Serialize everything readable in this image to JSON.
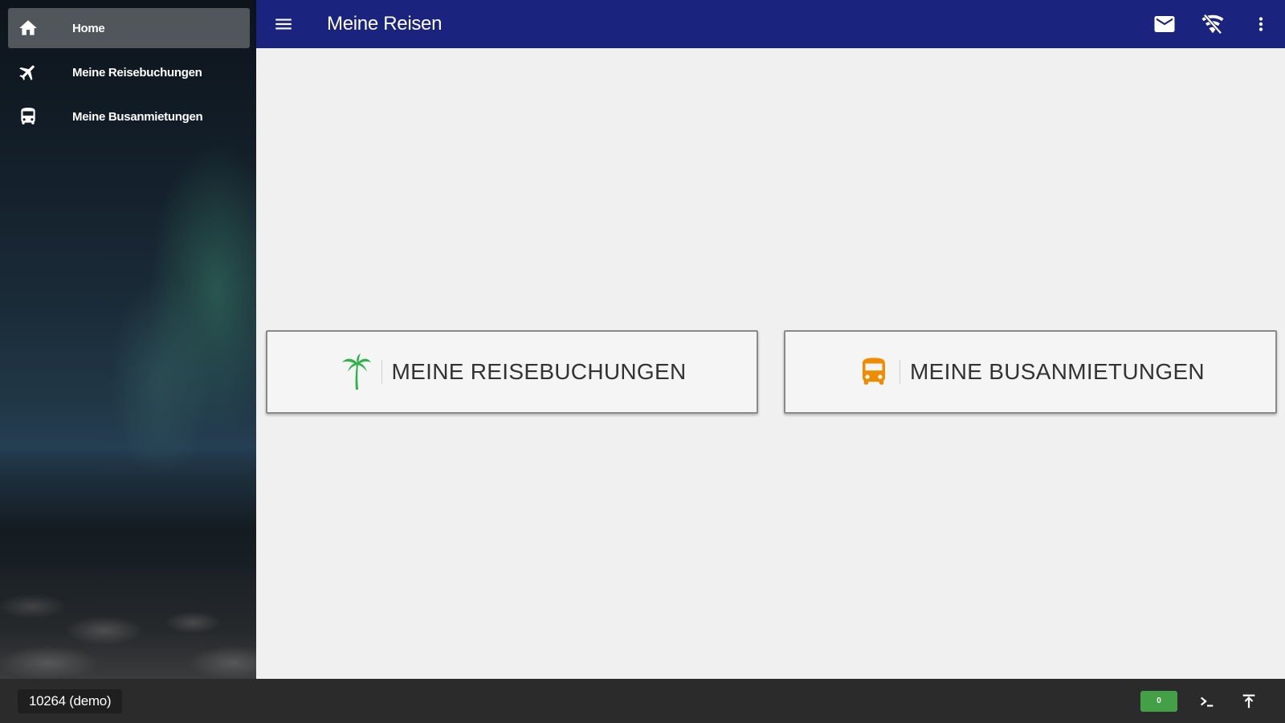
{
  "sidebar": {
    "items": [
      {
        "label": "Home",
        "icon": "home-icon",
        "active": true
      },
      {
        "label": "Meine Reisebuchungen",
        "icon": "airplane-icon",
        "active": false
      },
      {
        "label": "Meine Busanmietungen",
        "icon": "bus-icon",
        "active": false
      }
    ]
  },
  "appbar": {
    "title": "Meine Reisen",
    "color": "#1a237e",
    "actions": [
      "mail-icon",
      "no-signal-icon",
      "more-vert-icon"
    ]
  },
  "main": {
    "tiles": [
      {
        "label": "MEINE REISEBUCHUNGEN",
        "icon": "palm-tree-icon",
        "icon_color": "#2db34a"
      },
      {
        "label": "MEINE BUSANMIETUNGEN",
        "icon": "bus-icon",
        "icon_color": "#f08c00"
      }
    ]
  },
  "bottombar": {
    "user": "10264 (demo)",
    "badge": "0",
    "badge_color": "#43a047",
    "icons": [
      "terminal-icon",
      "scroll-top-icon"
    ]
  }
}
